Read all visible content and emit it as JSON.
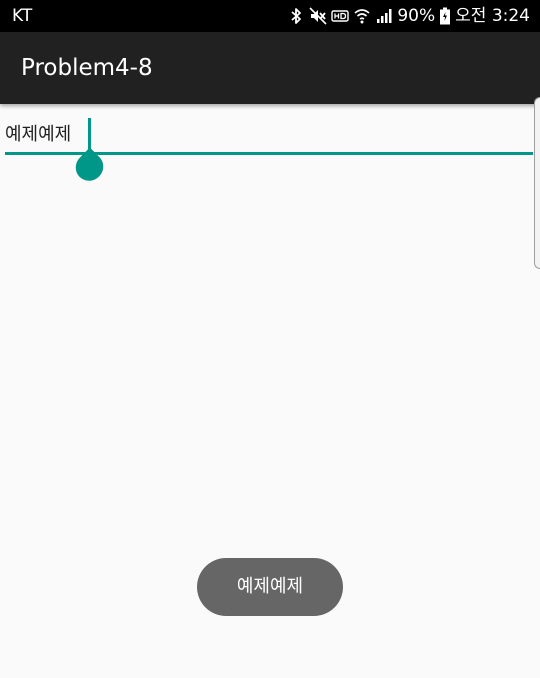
{
  "status_bar": {
    "carrier": "KT",
    "battery": "90%",
    "time": "오전 3:24",
    "icons": [
      "bluetooth-icon",
      "mute-icon",
      "hd-icon",
      "wifi-icon",
      "signal-icon",
      "battery-icon"
    ]
  },
  "app_bar": {
    "title": "Problem4-8"
  },
  "edit_text": {
    "value": "예제예제"
  },
  "toast": {
    "message": "예제예제"
  },
  "colors": {
    "accent": "#009688",
    "app_bar": "#212121",
    "status_bar": "#000000",
    "background": "#fafafa",
    "toast": "#666666"
  }
}
